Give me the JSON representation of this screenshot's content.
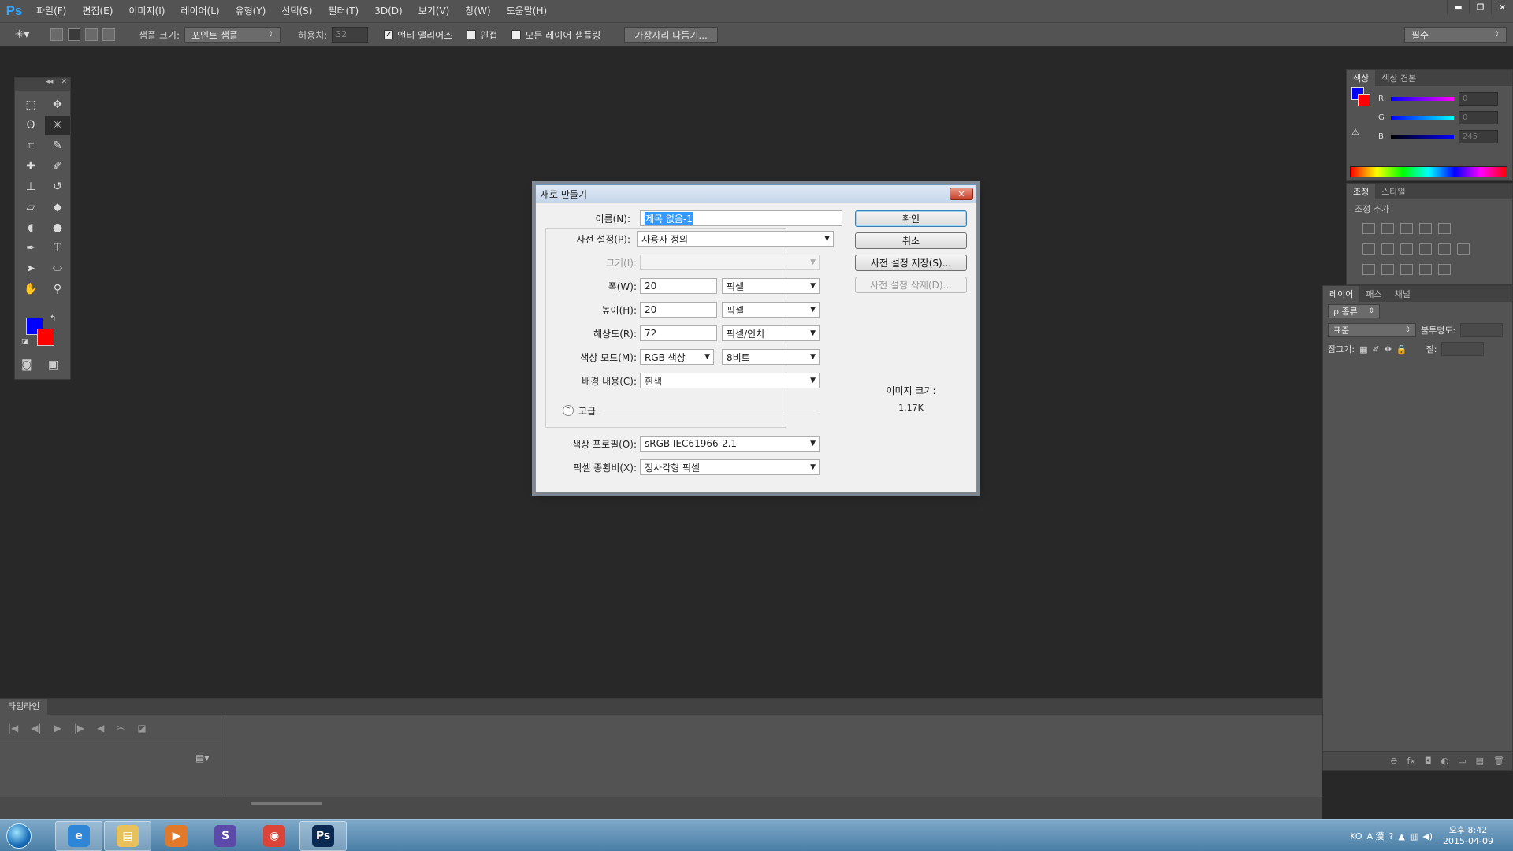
{
  "app": {
    "logo": "Ps",
    "menus": [
      "파일(F)",
      "편집(E)",
      "이미지(I)",
      "레이어(L)",
      "유형(Y)",
      "선택(S)",
      "필터(T)",
      "3D(D)",
      "보기(V)",
      "창(W)",
      "도움말(H)"
    ],
    "window_controls": [
      "▬",
      "❐",
      "✕"
    ]
  },
  "options_bar": {
    "sample_size_label": "샘플 크기:",
    "sample_size_value": "포인트 샘플",
    "tolerance_label": "허용치:",
    "tolerance_value": "32",
    "anti_alias_label": "앤티 앨리어스",
    "anti_alias_checked": true,
    "contiguous_label": "인접",
    "contiguous_checked": false,
    "sample_all_label": "모든 레이어 샘플링",
    "sample_all_checked": false,
    "refine_edge_label": "가장자리 다듬기...",
    "workspace_value": "필수"
  },
  "tools": {
    "colors": {
      "foreground": "#0000ff",
      "background": "#ff0000"
    }
  },
  "color_panel": {
    "tabs": [
      "색상",
      "색상 견본"
    ],
    "channels": [
      {
        "label": "R",
        "value": "0",
        "gradient": "linear-gradient(to right,#0000ff,#ff00ff)"
      },
      {
        "label": "G",
        "value": "0",
        "gradient": "linear-gradient(to right,#0000ff,#00ffff)"
      },
      {
        "label": "B",
        "value": "245",
        "gradient": "linear-gradient(to right,#000000,#0000ff)"
      }
    ]
  },
  "adjust_panel": {
    "tabs": [
      "조정",
      "스타일"
    ],
    "title": "조정 추가"
  },
  "layers_panel": {
    "tabs": [
      "레이어",
      "패스",
      "채널"
    ],
    "kind_label": "ρ 종류",
    "blend_mode": "표준",
    "opacity_label": "불투명도:",
    "lock_label": "잠그기:",
    "fill_label": "칠:",
    "footer_icons": [
      "⊖",
      "fx",
      "◘",
      "◐",
      "▭",
      "▤",
      "🗑"
    ]
  },
  "timeline": {
    "tab": "타임라인",
    "controls": [
      "|◀",
      "◀|",
      "▶",
      "|▶",
      "◀",
      "✂",
      "◪"
    ]
  },
  "dialog": {
    "title": "새로 만들기",
    "close": "✕",
    "name_label": "이름(N):",
    "name_value": "제목 없음-1",
    "preset_label": "사전 설정(P):",
    "preset_value": "사용자 정의",
    "size_label": "크기(I):",
    "width_label": "폭(W):",
    "width_value": "20",
    "width_unit": "픽셀",
    "height_label": "높이(H):",
    "height_value": "20",
    "height_unit": "픽셀",
    "resolution_label": "해상도(R):",
    "resolution_value": "72",
    "resolution_unit": "픽셀/인치",
    "color_mode_label": "색상 모드(M):",
    "color_mode_value": "RGB 색상",
    "bit_depth_value": "8비트",
    "background_label": "배경 내용(C):",
    "background_value": "흰색",
    "advanced_label": "고급",
    "color_profile_label": "색상 프로필(O):",
    "color_profile_value": "sRGB IEC61966-2.1",
    "pixel_aspect_label": "픽셀 종횡비(X):",
    "pixel_aspect_value": "정사각형 픽셀",
    "ok_button": "확인",
    "cancel_button": "취소",
    "save_preset_button": "사전 설정 저장(S)...",
    "delete_preset_button": "사전 설정 삭제(D)...",
    "image_size_label": "이미지 크기:",
    "image_size_value": "1.17K"
  },
  "taskbar": {
    "apps": [
      {
        "name": "internet-explorer",
        "glyph": "e",
        "color": "#2f86d6",
        "active": true
      },
      {
        "name": "file-explorer",
        "glyph": "▤",
        "color": "#e7c25c",
        "active": true
      },
      {
        "name": "media-player",
        "glyph": "▶",
        "color": "#e07a2a",
        "active": false
      },
      {
        "name": "s-app",
        "glyph": "S",
        "color": "#5b4aa8",
        "active": false
      },
      {
        "name": "chrome",
        "glyph": "◉",
        "color": "#db4437",
        "active": false
      },
      {
        "name": "photoshop",
        "glyph": "Ps",
        "color": "#0b2a52",
        "active": true
      }
    ],
    "tray_text": "KO",
    "time": "오후 8:42",
    "date": "2015-04-09"
  }
}
